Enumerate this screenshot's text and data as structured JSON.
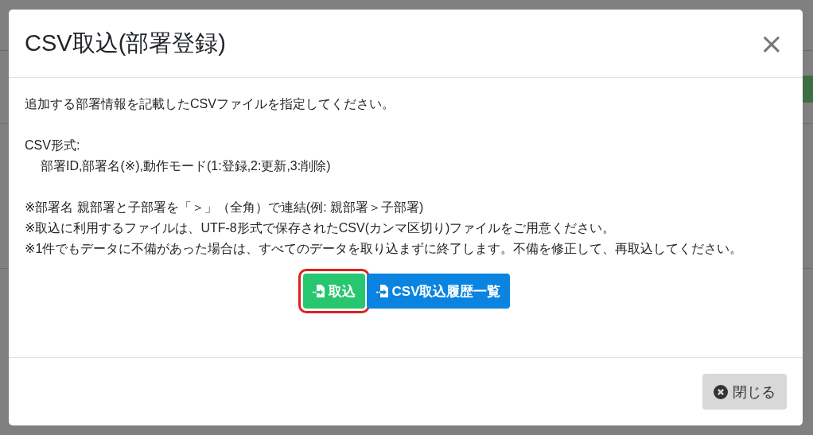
{
  "dialog": {
    "title": "CSV取込(部署登録)",
    "close_symbol": "×",
    "intro": "追加する部署情報を記載したCSVファイルを指定してください。",
    "format_label": "CSV形式:",
    "format_value": "部署ID,部署名(※),動作モード(1:登録,2:更新,3:削除)",
    "notes": [
      "※部署名 親部署と子部署を「＞」（全角）で連結(例: 親部署＞子部署)",
      "※取込に利用するファイルは、UTF-8形式で保存されたCSV(カンマ区切り)ファイルをご用意ください。",
      "※1件でもデータに不備があった場合は、すべてのデータを取り込まずに終了します。不備を修正して、再取込してください。"
    ],
    "actions": [
      {
        "label": "取込",
        "kind": "import",
        "highlighted": true
      },
      {
        "label": "CSV取込履歴一覧",
        "kind": "history",
        "highlighted": false
      }
    ],
    "footer_button": "閉じる"
  }
}
